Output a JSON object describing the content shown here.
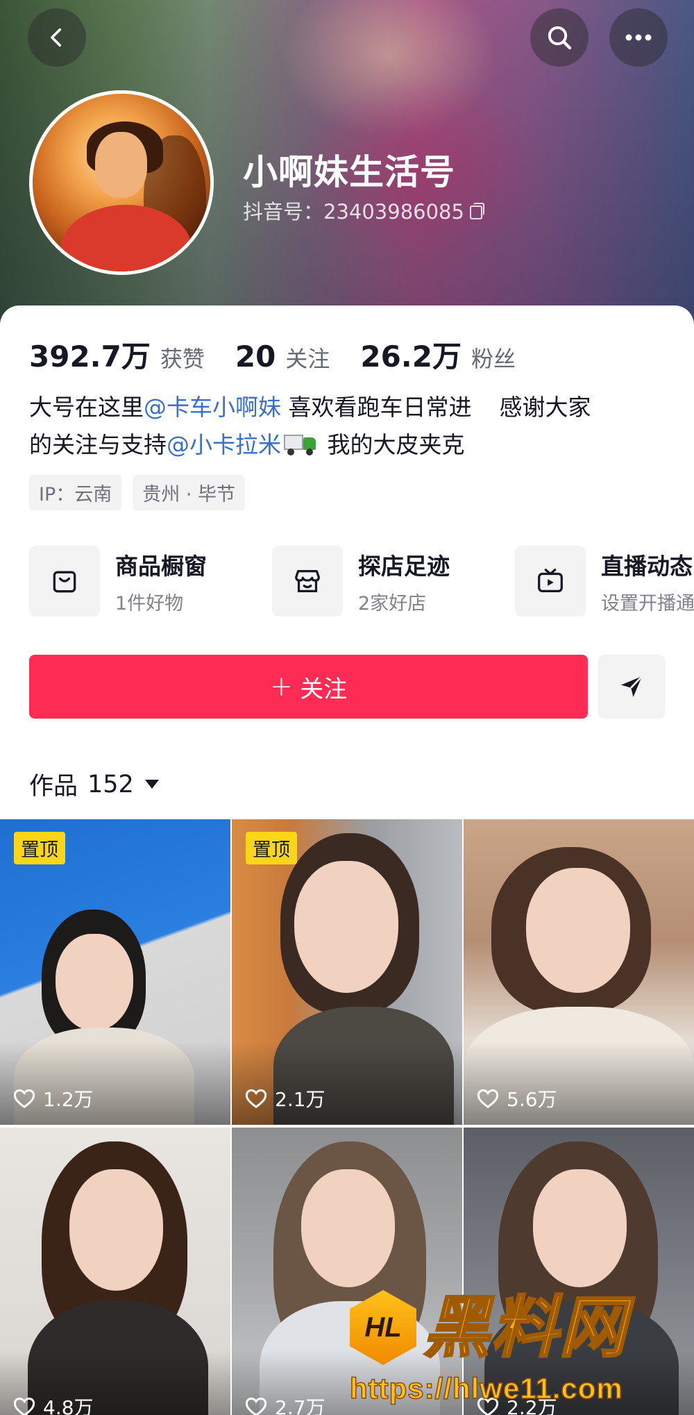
{
  "header": {
    "back_icon": "chevron-left-icon",
    "search_icon": "search-icon",
    "more_icon": "more-dots-icon"
  },
  "profile": {
    "nickname": "小啊妹生活号",
    "douyin_id": "抖音号：23403986085",
    "copy_icon": "copy-icon"
  },
  "stats": [
    {
      "value": "392.7万",
      "label": "获赞"
    },
    {
      "value": "20",
      "label": "关注"
    },
    {
      "value": "26.2万",
      "label": "粉丝"
    }
  ],
  "bio": {
    "p1": "大号在这里",
    "m1": "@卡车小啊妹",
    "p2": "喜欢看跑车日常进",
    "p3": "感谢大家",
    "p4": "的关注与支持",
    "m2": "@小卡拉米",
    "p5": "我的大皮夹克",
    "emoji": "delivery-truck-icon"
  },
  "tags": [
    "IP：云南",
    "贵州 · 毕节"
  ],
  "shortcuts": [
    {
      "title": "商品橱窗",
      "sub": "1件好物",
      "icon": "shopping-bag-icon"
    },
    {
      "title": "探店足迹",
      "sub": "2家好店",
      "icon": "store-icon"
    },
    {
      "title": "直播动态",
      "sub": "设置开播通",
      "icon": "tv-icon"
    }
  ],
  "actions": {
    "follow_plus": "+",
    "follow_label": "关注",
    "share_icon": "send-icon"
  },
  "works": {
    "label": "作品",
    "count": "152",
    "tiles": [
      {
        "pinned": "置顶",
        "likes": "1.2万"
      },
      {
        "pinned": "置顶",
        "likes": "2.1万"
      },
      {
        "pinned": "",
        "likes": "5.6万"
      },
      {
        "pinned": "",
        "likes": "4.8万"
      },
      {
        "pinned": "",
        "likes": "2.7万"
      },
      {
        "pinned": "",
        "likes": "2.2万"
      }
    ]
  },
  "watermark": {
    "logo": "HL",
    "title": "黑料网",
    "url": "https://hlwe11.com"
  },
  "colors": {
    "accent": "#fe2c55",
    "mention": "#3a6ecf",
    "pin_badge": "#fad619"
  }
}
